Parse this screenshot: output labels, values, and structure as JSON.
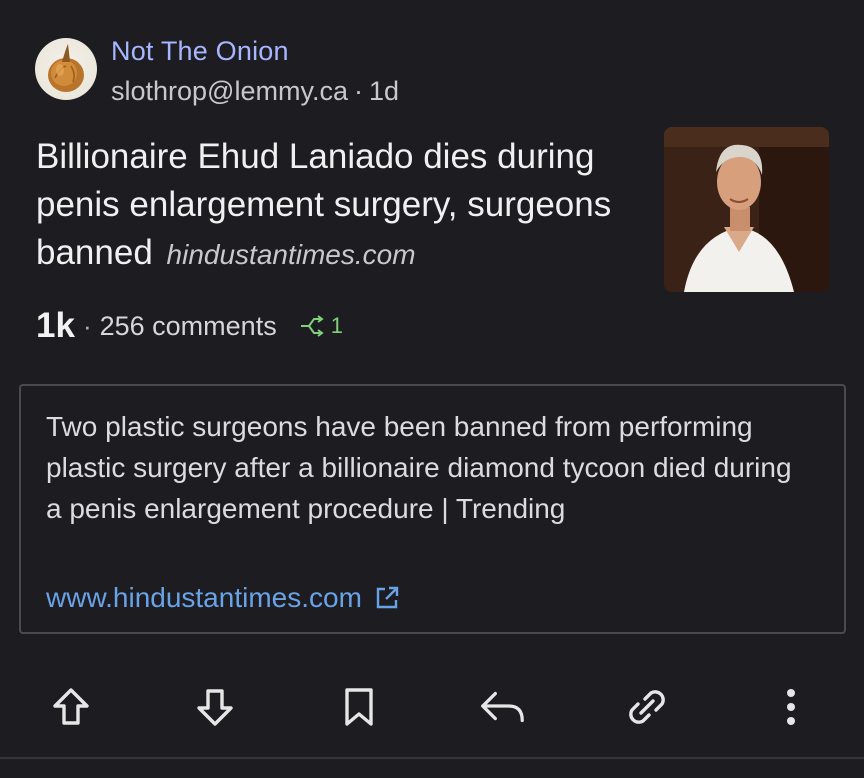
{
  "post": {
    "community": "Not The Onion",
    "author": "slothrop@lemmy.ca",
    "age": "1d",
    "title": "Billionaire Ehud Laniado dies during penis enlargement surgery, surgeons banned",
    "domain": "hindustantimes.com",
    "score": "1k",
    "comments": "256 comments",
    "crossposts": "1"
  },
  "embed": {
    "description": "Two plastic surgeons have been banned from performing plastic surgery after a billionaire diamond tycoon died during a penis enlargement procedure | Trending",
    "url": "www.hindustantimes.com"
  },
  "icons": {
    "avatar": "onion-avatar",
    "crosspost": "crosspost-icon",
    "external": "external-link-icon",
    "upvote": "arrow-up-icon",
    "downvote": "arrow-down-icon",
    "save": "bookmark-icon",
    "reply": "reply-icon",
    "share": "link-icon",
    "more": "more-vertical-icon"
  },
  "colors": {
    "background": "#1c1c21",
    "community": "#a8b6ff",
    "link": "#6aa2e8",
    "crosspost": "#7fd17c"
  }
}
